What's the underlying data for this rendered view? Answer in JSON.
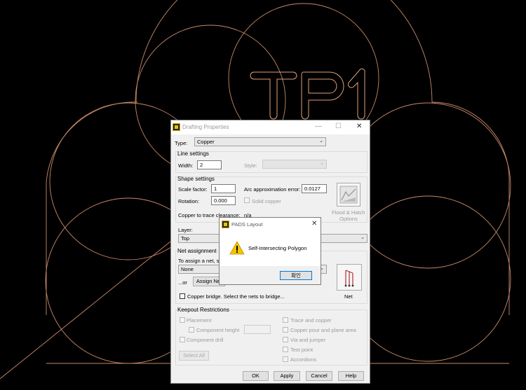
{
  "layout_canvas": {
    "part_label": "TP1",
    "colors": {
      "background": "#000000",
      "outline": "#c8896a",
      "text_outline": "#e0a078"
    }
  },
  "drafting_window": {
    "title": "Drafting Properties",
    "type_label": "Type:",
    "type_value": "Copper",
    "line_settings": {
      "title": "Line settings",
      "width_label": "Width:",
      "width_value": "2",
      "style_label": "Style:"
    },
    "shape_settings": {
      "title": "Shape settings",
      "scale_label": "Scale factor:",
      "scale_value": "1",
      "arc_label": "Arc approximation error:",
      "arc_value": "0.0127",
      "rotation_label": "Rotation:",
      "rotation_value": "0.000",
      "solid_copper_label": "Solid copper",
      "clearance_label": "Copper to trace clearance:",
      "clearance_value": "n/a",
      "flood_label_1": "Flood & Hatch",
      "flood_label_2": "Options"
    },
    "layer": {
      "label": "Layer:",
      "value": "Top"
    },
    "net_assignment": {
      "title": "Net assignment",
      "instruction": "To assign a net, se",
      "net_value": "None",
      "or_label": "...or",
      "assign_button": "Assign Net",
      "net_button_label": "Net"
    },
    "copper_bridge_label": "Copper bridge. Select the nets to bridge...",
    "keepout": {
      "title": "Keepout Restrictions",
      "placement": "Placement",
      "component_height": "Component height",
      "component_drill": "Component drill",
      "select_all": "Select All",
      "trace_copper": "Trace and copper",
      "copper_pour": "Copper pour and plane area",
      "via_jumper": "Via and jumper",
      "test_point": "Test point",
      "accordions": "Accordions"
    },
    "buttons": {
      "ok": "OK",
      "apply": "Apply",
      "cancel": "Cancel",
      "help": "Help"
    }
  },
  "message_box": {
    "title": "PADS Layout",
    "message": "Self-Intersecting Polygon",
    "button": "확인"
  }
}
